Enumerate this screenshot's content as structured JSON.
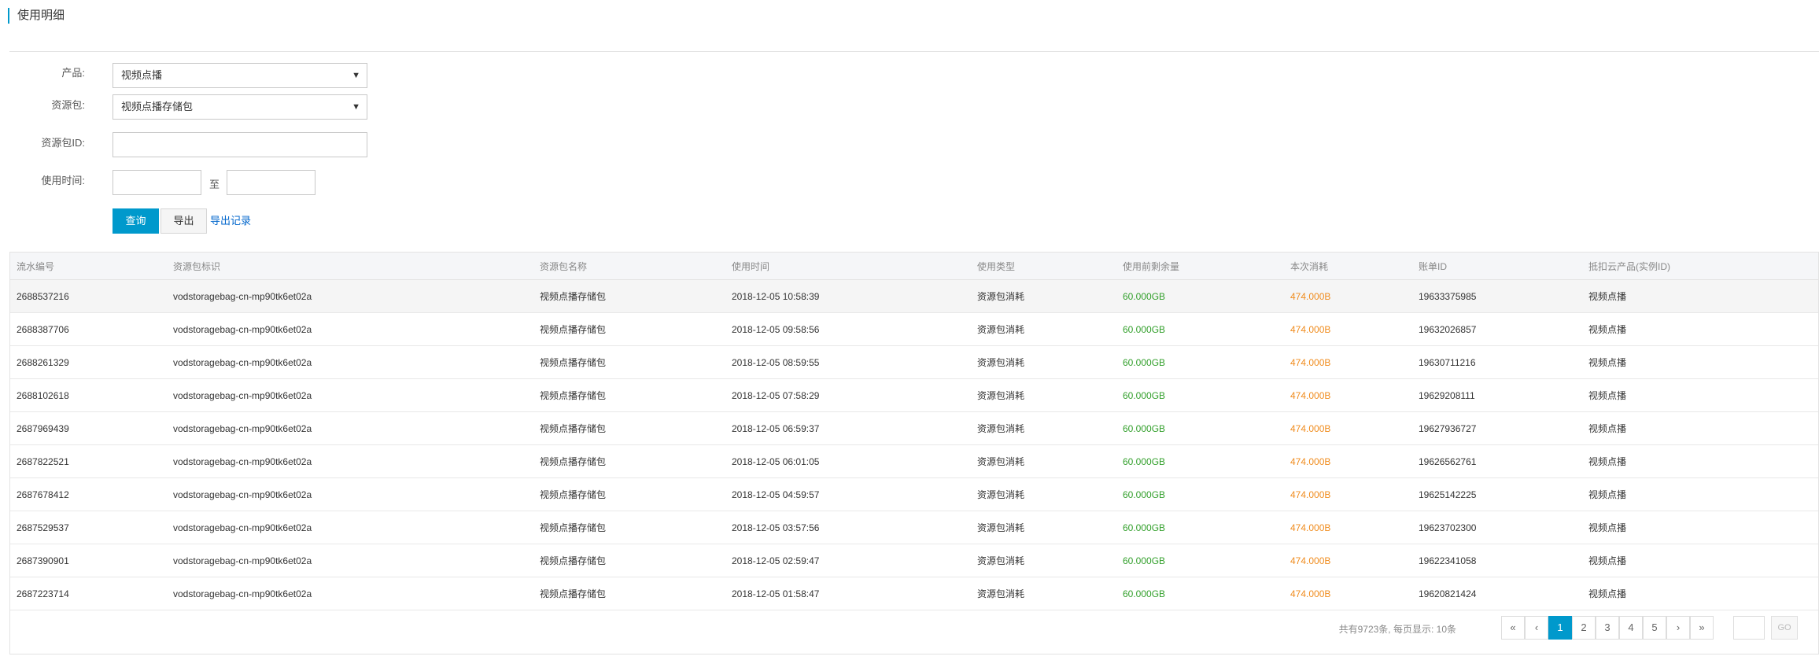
{
  "page": {
    "title": "使用明细"
  },
  "form": {
    "product_label": "产品:",
    "product_value": "视频点播",
    "package_label": "资源包:",
    "package_value": "视频点播存储包",
    "package_id_label": "资源包ID:",
    "package_id_value": "",
    "time_label": "使用时间:",
    "time_start": "",
    "time_end": "",
    "time_sep": "至",
    "query_label": "查询",
    "export_label": "导出",
    "export_record_label": "导出记录"
  },
  "table": {
    "headers": [
      "流水编号",
      "资源包标识",
      "资源包名称",
      "使用时间",
      "使用类型",
      "使用前剩余量",
      "本次消耗",
      "账单ID",
      "抵扣云产品(实例ID)"
    ],
    "rows": [
      [
        "2688537216",
        "vodstoragebag-cn-mp90tk6et02a",
        "视频点播存储包",
        "2018-12-05 10:58:39",
        "资源包消耗",
        "60.000GB",
        "474.000B",
        "19633375985",
        "视频点播"
      ],
      [
        "2688387706",
        "vodstoragebag-cn-mp90tk6et02a",
        "视频点播存储包",
        "2018-12-05 09:58:56",
        "资源包消耗",
        "60.000GB",
        "474.000B",
        "19632026857",
        "视频点播"
      ],
      [
        "2688261329",
        "vodstoragebag-cn-mp90tk6et02a",
        "视频点播存储包",
        "2018-12-05 08:59:55",
        "资源包消耗",
        "60.000GB",
        "474.000B",
        "19630711216",
        "视频点播"
      ],
      [
        "2688102618",
        "vodstoragebag-cn-mp90tk6et02a",
        "视频点播存储包",
        "2018-12-05 07:58:29",
        "资源包消耗",
        "60.000GB",
        "474.000B",
        "19629208111",
        "视频点播"
      ],
      [
        "2687969439",
        "vodstoragebag-cn-mp90tk6et02a",
        "视频点播存储包",
        "2018-12-05 06:59:37",
        "资源包消耗",
        "60.000GB",
        "474.000B",
        "19627936727",
        "视频点播"
      ],
      [
        "2687822521",
        "vodstoragebag-cn-mp90tk6et02a",
        "视频点播存储包",
        "2018-12-05 06:01:05",
        "资源包消耗",
        "60.000GB",
        "474.000B",
        "19626562761",
        "视频点播"
      ],
      [
        "2687678412",
        "vodstoragebag-cn-mp90tk6et02a",
        "视频点播存储包",
        "2018-12-05 04:59:57",
        "资源包消耗",
        "60.000GB",
        "474.000B",
        "19625142225",
        "视频点播"
      ],
      [
        "2687529537",
        "vodstoragebag-cn-mp90tk6et02a",
        "视频点播存储包",
        "2018-12-05 03:57:56",
        "资源包消耗",
        "60.000GB",
        "474.000B",
        "19623702300",
        "视频点播"
      ],
      [
        "2687390901",
        "vodstoragebag-cn-mp90tk6et02a",
        "视频点播存储包",
        "2018-12-05 02:59:47",
        "资源包消耗",
        "60.000GB",
        "474.000B",
        "19622341058",
        "视频点播"
      ],
      [
        "2687223714",
        "vodstoragebag-cn-mp90tk6et02a",
        "视频点播存储包",
        "2018-12-05 01:58:47",
        "资源包消耗",
        "60.000GB",
        "474.000B",
        "19620821424",
        "视频点播"
      ]
    ]
  },
  "pagination": {
    "summary": "共有9723条, 每页显示: 10条",
    "first": "«",
    "prev": "‹",
    "pages": [
      "1",
      "2",
      "3",
      "4",
      "5"
    ],
    "active_page": "1",
    "next": "›",
    "last": "»",
    "jump_value": "",
    "go_label": "GO"
  },
  "colors": {
    "accent": "#0099cc",
    "remaining": "#33a02c",
    "consumed": "#f08c1e",
    "link": "#0066cc"
  },
  "icons": {
    "select_arrow": "caret-down-icon"
  }
}
